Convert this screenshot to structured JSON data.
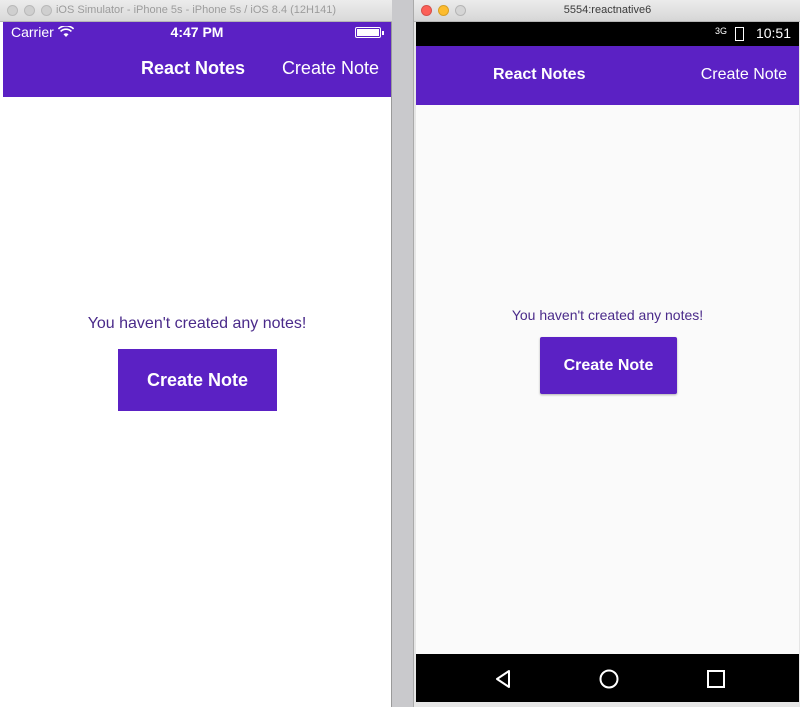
{
  "ios": {
    "window_title": "iOS Simulator - iPhone 5s - iPhone 5s / iOS 8.4 (12H141)",
    "status": {
      "carrier": "Carrier",
      "time": "4:47 PM"
    },
    "navbar": {
      "title": "React Notes",
      "right_button": "Create Note"
    },
    "empty_message": "You haven't created any notes!",
    "create_button": "Create Note"
  },
  "android": {
    "window_title": "5554:reactnative6",
    "status": {
      "network": "3G",
      "time": "10:51"
    },
    "toolbar": {
      "title": "React Notes",
      "right_button": "Create Note"
    },
    "empty_message": "You haven't created any notes!",
    "create_button": "Create Note",
    "navbar": {
      "back_icon": "back-icon",
      "home_icon": "home-icon",
      "recent_icon": "recents-icon"
    }
  },
  "colors": {
    "accent": "#5b21c4",
    "text": "#4a2a8a"
  }
}
